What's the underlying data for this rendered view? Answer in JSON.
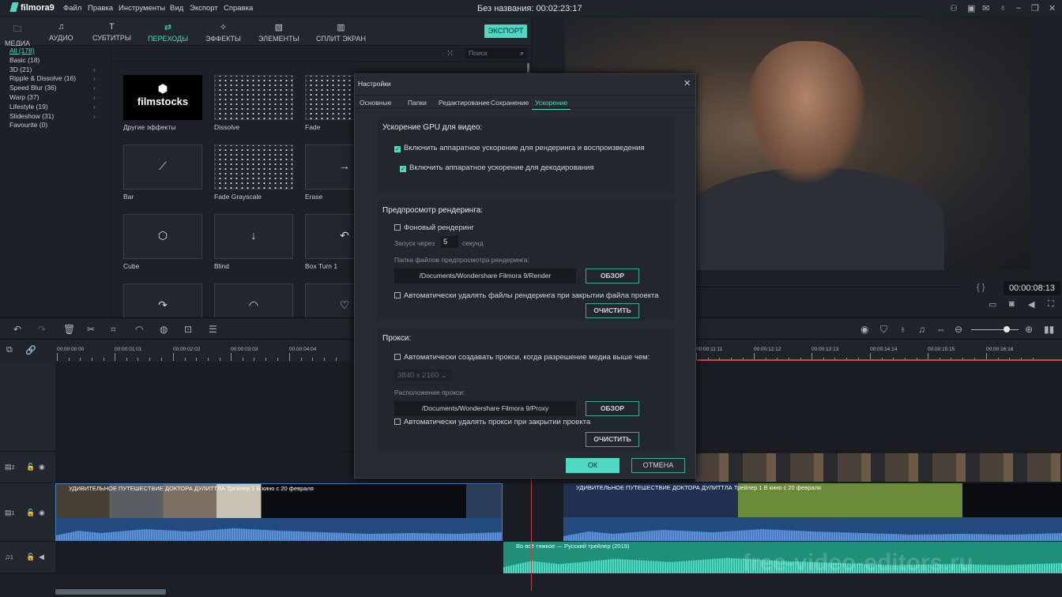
{
  "app": {
    "name": "filmora9",
    "project_title": "Без названия:",
    "project_time": "00:02:23:17"
  },
  "menu": [
    "Файл",
    "Правка",
    "Инструменты",
    "Вид",
    "Экспорт",
    "Справка"
  ],
  "window_icons": [
    "user-icon",
    "save-icon",
    "mail-icon",
    "mic-icon",
    "minimize-icon",
    "restore-icon",
    "close-icon"
  ],
  "tabs": [
    {
      "label": "МЕДИА",
      "icon": "folder-icon"
    },
    {
      "label": "АУДИО",
      "icon": "music-icon"
    },
    {
      "label": "СУБТИТРЫ",
      "icon": "text-icon"
    },
    {
      "label": "ПЕРЕХОДЫ",
      "icon": "transition-icon",
      "active": true
    },
    {
      "label": "ЭФФЕКТЫ",
      "icon": "effects-icon"
    },
    {
      "label": "ЭЛЕМЕНТЫ",
      "icon": "image-icon"
    },
    {
      "label": "СПЛИТ ЭКРАН",
      "icon": "split-icon"
    }
  ],
  "export_label": "ЭКСПОРТ",
  "categories": [
    {
      "label": "All (178)",
      "active": true
    },
    {
      "label": "Basic (18)"
    },
    {
      "label": "3D (21)",
      "sub": true
    },
    {
      "label": "Ripple & Dissolve (16)",
      "sub": true
    },
    {
      "label": "Speed Blur (36)",
      "sub": true
    },
    {
      "label": "Warp (37)",
      "sub": true
    },
    {
      "label": "Lifestyle (19)",
      "sub": true
    },
    {
      "label": "Slideshow (31)",
      "sub": true
    },
    {
      "label": "Favourite (0)"
    }
  ],
  "search_placeholder": "Поиск",
  "transitions": [
    {
      "label": "Другие эффекты",
      "logo": "filmstocks"
    },
    {
      "label": "Dissolve"
    },
    {
      "label": "Fade"
    },
    {
      "label": "Bar"
    },
    {
      "label": "Fade Grayscale"
    },
    {
      "label": "Erase"
    },
    {
      "label": "Cube"
    },
    {
      "label": "Blind"
    },
    {
      "label": "Box Turn 1"
    },
    {
      "label": ""
    },
    {
      "label": ""
    },
    {
      "label": ""
    }
  ],
  "preview": {
    "timecode": "00:00:08:13"
  },
  "ruler": [
    "00:00:00:00",
    "00:00:01:01",
    "00:00:02:02",
    "00:00:03:03",
    "00:00:04:04",
    "00:00:11:11",
    "00:00:12:12",
    "00:00:13:13",
    "00:00:14:14",
    "00:00:15:15",
    "00:00:16:16"
  ],
  "tracks": [
    {
      "label": "2"
    },
    {
      "label": "1"
    },
    {
      "label": "1"
    }
  ],
  "clips": {
    "v1_title": "УДИВИТЕЛЬНОЕ ПУТЕШЕСТВИЕ ДОКТОРА ДУЛИТТЛА Трейлер 1 В кино с 20 февраля",
    "v1r_title": "УДИВИТЕЛЬНОЕ ПУТЕШЕСТВИЕ ДОКТОРА ДУЛИТТЛА Трейлер 1 В кино с 20 февраля",
    "a1_title": "Во всё тяжкое — Русский трейлер (2019)"
  },
  "watermark": "free-video-editors.ru",
  "dialog": {
    "title": "Настройки",
    "tabs": [
      "Основные",
      "Папки",
      "Редактирование",
      "Сохранение",
      "Ускорение"
    ],
    "gpu": {
      "heading": "Ускорение GPU для видео:",
      "opt1": "Включить аппаратное ускорение для рендеринга и воспроизведения",
      "opt1_checked": true,
      "opt2": "Включить аппаратное ускорение для декодирования",
      "opt2_checked": true
    },
    "render": {
      "heading": "Предпросмотр рендеринга:",
      "bg": "Фоновый рендеринг",
      "bg_checked": false,
      "start_prefix": "Запуск через",
      "start_value": "5",
      "start_suffix": "секунд",
      "folder_label": "Папка файлов предпросмотра рендеринга:",
      "folder": "/Documents/Wondershare Filmora 9/Render",
      "browse": "ОБЗОР",
      "autodel": "Автоматически удалять файлы рендеринга при закрытии файла проекта",
      "autodel_checked": false,
      "clear": "ОЧИСТИТЬ"
    },
    "proxy": {
      "heading": "Прокси:",
      "auto": "Автоматически создавать прокси, когда разрешение медиа выше чем:",
      "auto_checked": false,
      "resolution": "3840 x 2160",
      "loc_label": "Расположение прокси:",
      "folder": "/Documents/Wondershare Filmora 9/Proxy",
      "browse": "ОБЗОР",
      "autodel": "Автоматически удалять прокси при закрытии проекта",
      "autodel_checked": false,
      "clear": "ОЧИСТИТЬ"
    },
    "ok": "ОК",
    "cancel": "ОТМЕНА"
  },
  "colors": {
    "accent": "#4fd8c4",
    "video_clip": "#234a7c",
    "audio_clip": "#1f8f78",
    "playhead": "#c94b4b"
  }
}
